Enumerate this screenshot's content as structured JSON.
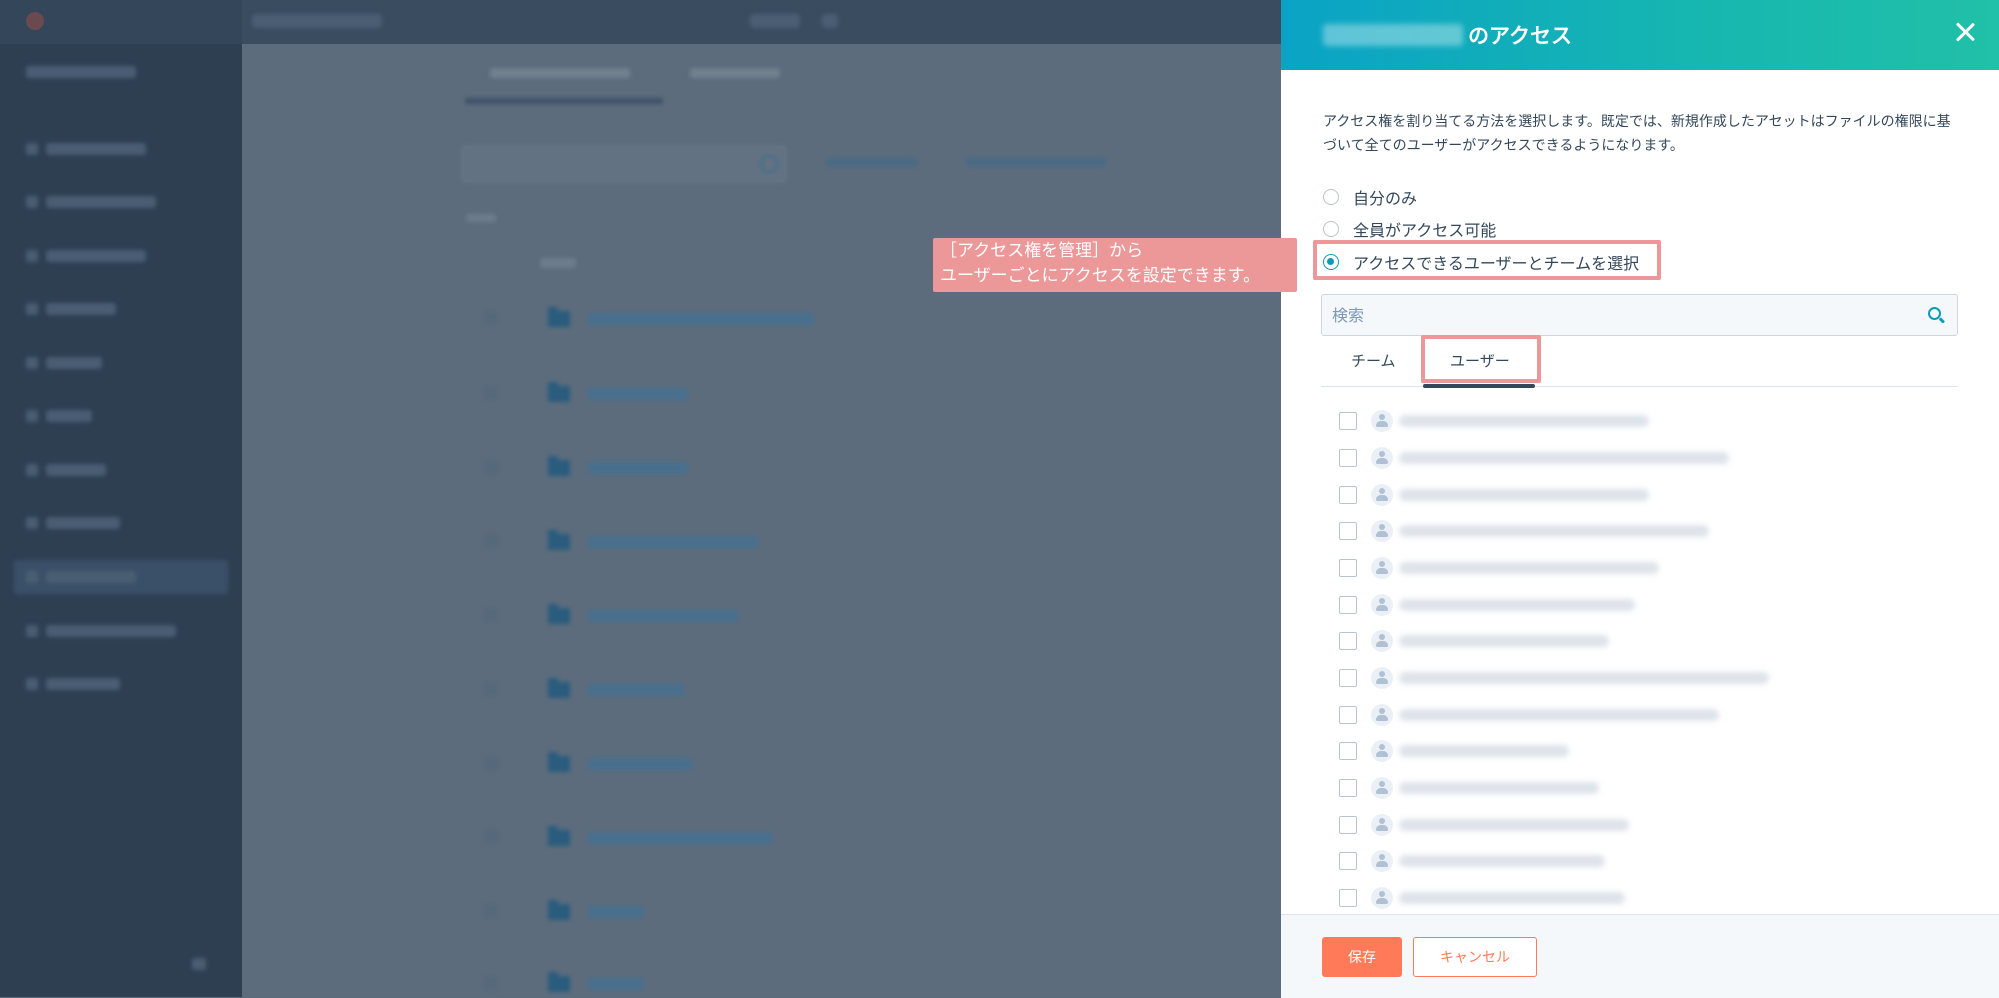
{
  "panel": {
    "title": "のアクセス",
    "description": "アクセス権を割り当てる方法を選択します。既定では、新規作成したアセットはファイルの権限に基づいて全てのユーザーがアクセスできるようになります。",
    "options": [
      {
        "label": "自分のみ",
        "checked": false
      },
      {
        "label": "全員がアクセス可能",
        "checked": false
      },
      {
        "label": "アクセスできるユーザーとチームを選択",
        "checked": true
      }
    ],
    "search": {
      "placeholder": "検索"
    },
    "tabs": [
      {
        "label": "チーム",
        "active": false
      },
      {
        "label": "ユーザー",
        "active": true
      }
    ],
    "footer": {
      "save_label": "保存",
      "cancel_label": "キャンセル"
    }
  },
  "callout": {
    "line1": "［アクセス権を管理］から",
    "line2": "ユーザーごとにアクセスを設定できます。"
  },
  "colors": {
    "header_gradient_start": "#0aa3c6",
    "header_gradient_end": "#21c0a8",
    "highlight": "#ec9899",
    "primary_button": "#ff7a59",
    "radio_accent": "#0a9bb7"
  }
}
